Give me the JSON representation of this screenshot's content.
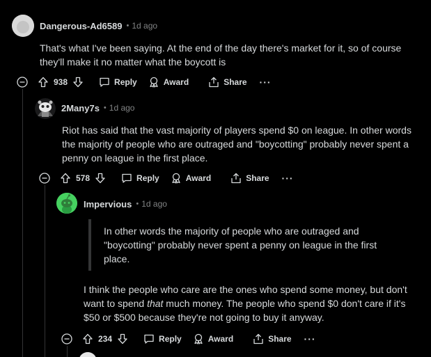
{
  "comments": [
    {
      "username": "Dangerous-Ad6589",
      "separator": "•",
      "time": "1d ago",
      "body_lines": [
        "That's what I've been saying. At the end of the day there's market for it, so of course",
        "they'll make it no matter what the boycott is"
      ],
      "votes": "938",
      "reply_label": "Reply",
      "award_label": "Award",
      "share_label": "Share",
      "more_label": "···"
    },
    {
      "username": "2Many7s",
      "separator": "•",
      "time": "1d ago",
      "body_lines": [
        "Riot has said that the vast majority of players spend $0 on league. In other words",
        "the majority of people who are outraged and \"boycotting\" probably never spent a",
        "penny on league in the first place."
      ],
      "votes": "578",
      "reply_label": "Reply",
      "award_label": "Award",
      "share_label": "Share",
      "more_label": "···"
    },
    {
      "username": "Impervious",
      "separator": "•",
      "time": "1d ago",
      "quote_lines": [
        "In other words the majority of people who are outraged and",
        "\"boycotting\" probably never spent a penny on league in the first",
        "place."
      ],
      "body_line1": "I think the people who care are the ones who spend some money, but don't",
      "body_line2_pre": "want to spend ",
      "body_line2_em": "that",
      "body_line2_post": " much money. The people who spend $0 don't care if it's",
      "body_line3": "$50 or $500 because they're not going to buy it anyway.",
      "votes": "234",
      "reply_label": "Reply",
      "award_label": "Award",
      "share_label": "Share",
      "more_label": "···"
    }
  ],
  "colors": {
    "background": "#000000",
    "text": "#d7dadc",
    "muted": "#818384",
    "thread_line": "#343536",
    "avatar_green": "#46d160"
  }
}
